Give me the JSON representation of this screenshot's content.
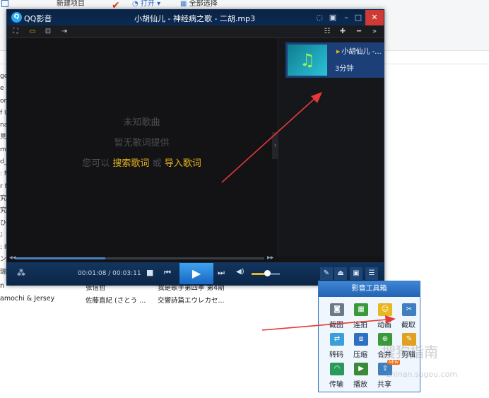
{
  "background": {
    "ribbon": {
      "new_item": "新建项目",
      "open": "打开",
      "select_all": "全部选择"
    },
    "left_fragments": [
      "ge",
      "e N",
      "on",
      "f U",
      "na",
      "見る",
      "m",
      "d_",
      ": M",
      "r N",
      "究",
      "究",
      "ひ",
      "冫か",
      ": P",
      "ン",
      "瑞"
    ],
    "rows": [
      {
        "artist": "n",
        "album": "张信哲",
        "title": "我是歌手第四季 第4期"
      },
      {
        "artist": "amochi & Jersey",
        "album": "佐藤直紀 (さとう ...",
        "title": "交響詩篇エウレカセ..."
      }
    ]
  },
  "player": {
    "app_name": "QQ影音",
    "window_title": "小胡仙儿 - 神经病之歌 - 二胡.mp3",
    "lyrics": {
      "unknown_song": "未知歌曲",
      "no_lyrics": "暂无歌词提供",
      "prompt_prefix": "您可以",
      "search_lyrics": "搜索歌词",
      "or": "或",
      "import_lyrics": "导入歌词"
    },
    "playlist": {
      "items": [
        {
          "title": "小胡仙儿 -...",
          "duration": "3分钟"
        }
      ]
    },
    "time_display": "00:01:08 / 00:03:11",
    "progress_fraction": 0.36,
    "volume_fraction": 0.55
  },
  "toolbox": {
    "title": "影音工具箱",
    "tools": [
      {
        "label": "截图",
        "icon": "camera-icon",
        "color": "#6a7a8a"
      },
      {
        "label": "连拍",
        "icon": "grid-icon",
        "color": "#3a9a3a"
      },
      {
        "label": "动画",
        "icon": "smiley-icon",
        "color": "#e8b820"
      },
      {
        "label": "截取",
        "icon": "clip-icon",
        "color": "#3f7fc0"
      },
      {
        "label": "转码",
        "icon": "convert-icon",
        "color": "#3aa0d8"
      },
      {
        "label": "压缩",
        "icon": "compress-icon",
        "color": "#2e6fc0"
      },
      {
        "label": "合并",
        "icon": "merge-icon",
        "color": "#3a9a3a"
      },
      {
        "label": "剪辑",
        "icon": "edit-icon",
        "color": "#e0a020"
      },
      {
        "label": "传输",
        "icon": "wifi-icon",
        "color": "#2a9a5a"
      },
      {
        "label": "播放",
        "icon": "play-icon",
        "color": "#3a8a3a"
      },
      {
        "label": "共享",
        "icon": "share-icon",
        "color": "#3f7fc0",
        "badge": "NEW"
      }
    ]
  },
  "watermark": {
    "text": "搜狗指南",
    "sub": "zhinan.sogou.com"
  }
}
